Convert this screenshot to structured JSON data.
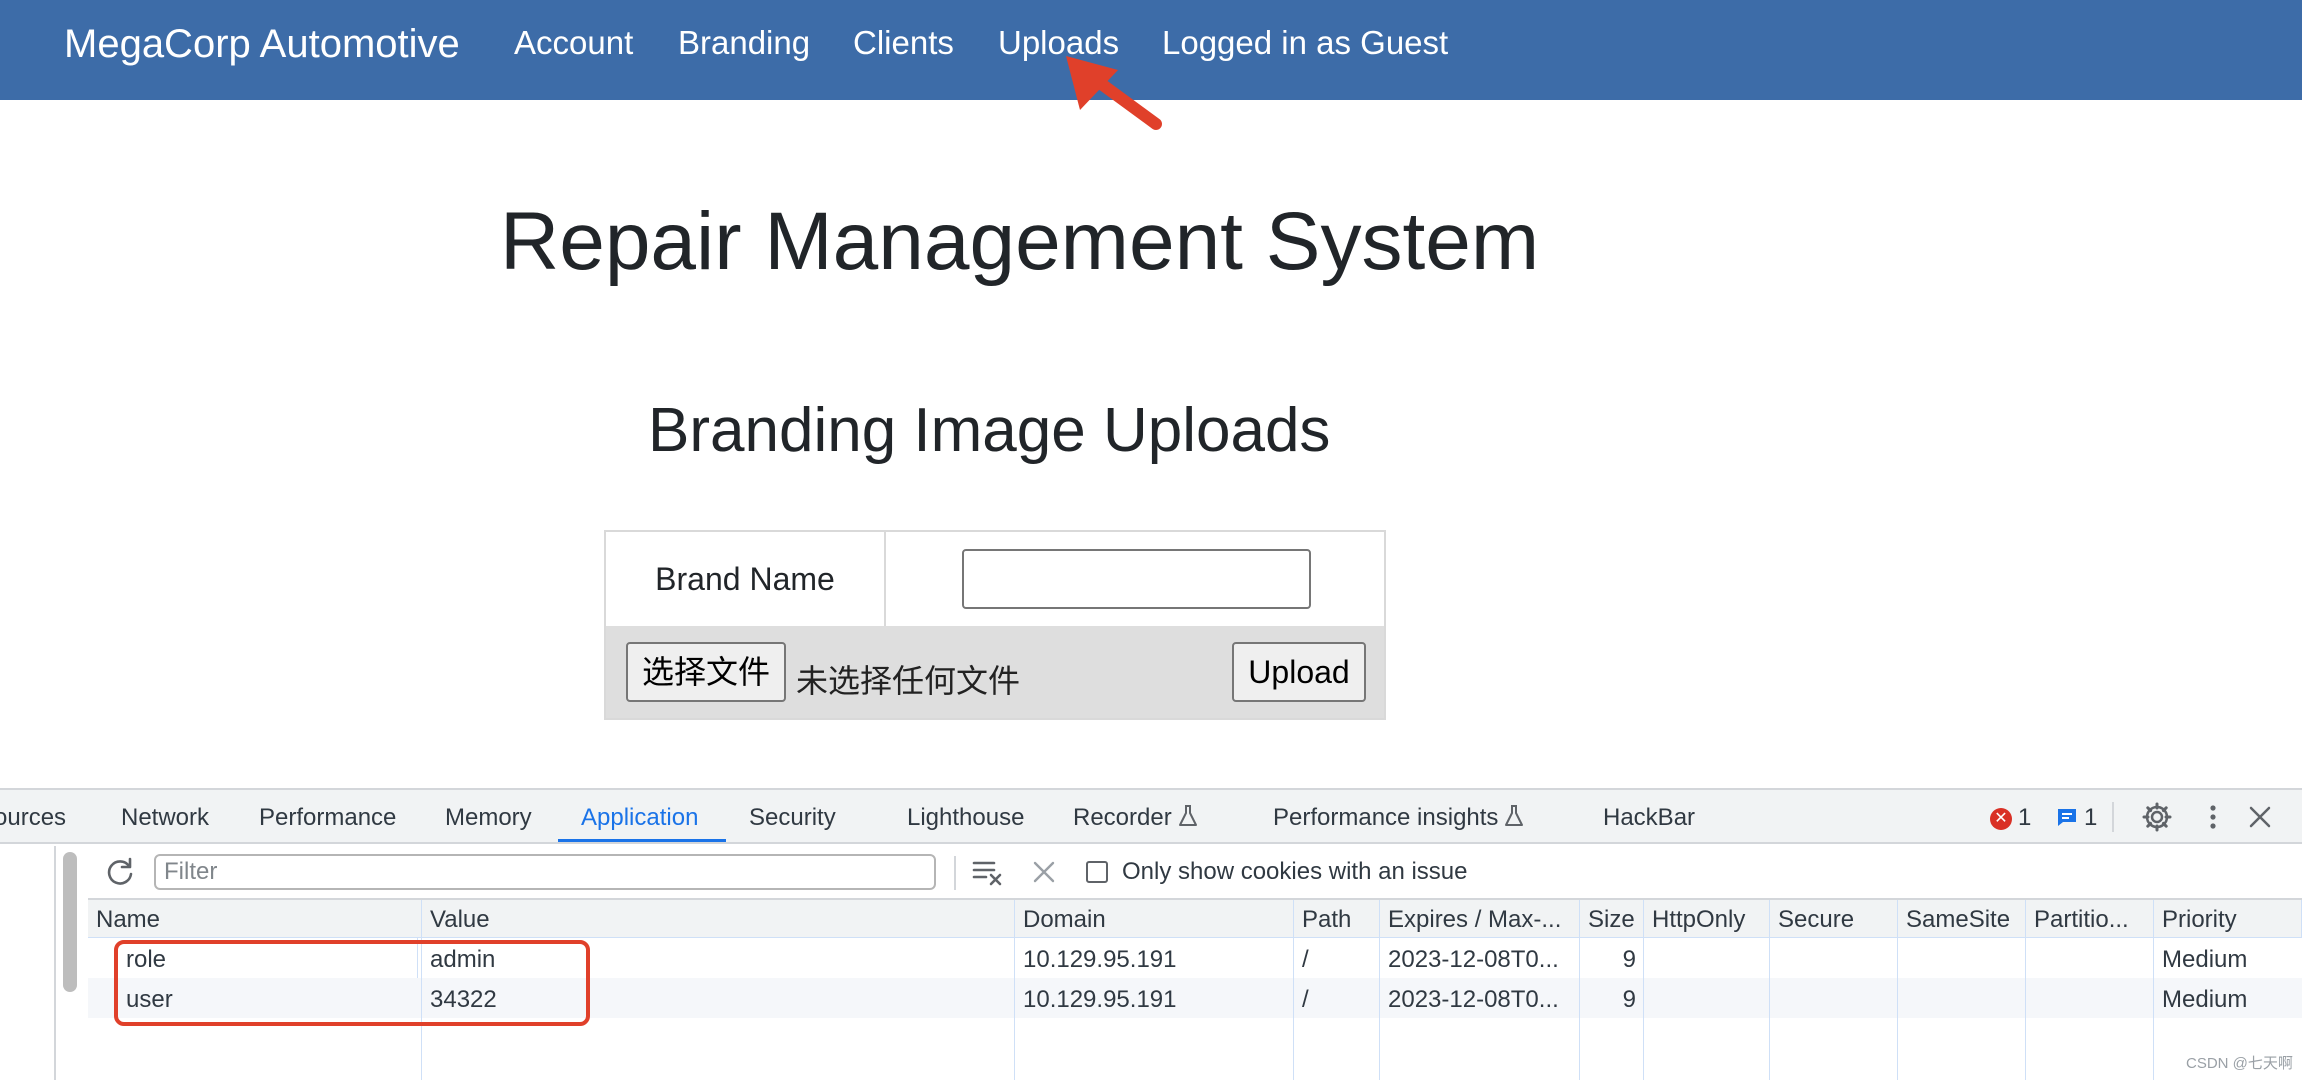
{
  "navbar": {
    "brand": "MegaCorp Automotive",
    "links": [
      "Account",
      "Branding",
      "Clients",
      "Uploads",
      "Logged in as Guest"
    ],
    "background": "#3d6ca8",
    "annotation_arrow_color": "#e0402a"
  },
  "main": {
    "title": "Repair Management System",
    "subtitle": "Branding Image Uploads",
    "form": {
      "brand_label": "Brand Name",
      "brand_value": "",
      "choose_file_label": "选择文件",
      "no_file_text": "未选择任何文件",
      "upload_label": "Upload"
    }
  },
  "devtools": {
    "tabs": [
      "ources",
      "Network",
      "Performance",
      "Memory",
      "Application",
      "Security",
      "Lighthouse",
      "Recorder",
      "Performance insights",
      "HackBar"
    ],
    "active_tab": "Application",
    "error_count": "1",
    "message_count": "1",
    "filter_placeholder": "Filter",
    "only_issues_label": "Only show cookies with an issue",
    "only_issues_checked": false,
    "columns": [
      "Name",
      "Value",
      "Domain",
      "Path",
      "Expires / Max-...",
      "Size",
      "HttpOnly",
      "Secure",
      "SameSite",
      "Partitio...",
      "Priority"
    ],
    "cookies": [
      {
        "name": "role",
        "value": "admin",
        "domain": "10.129.95.191",
        "path": "/",
        "expires": "2023-12-08T0...",
        "size": "9",
        "httponly": "",
        "secure": "",
        "samesite": "",
        "partition": "",
        "priority": "Medium"
      },
      {
        "name": "user",
        "value": "34322",
        "domain": "10.129.95.191",
        "path": "/",
        "expires": "2023-12-08T0...",
        "size": "9",
        "httponly": "",
        "secure": "",
        "samesite": "",
        "partition": "",
        "priority": "Medium"
      }
    ],
    "highlight_color": "#e0402a"
  },
  "watermark": "CSDN @七天啊"
}
